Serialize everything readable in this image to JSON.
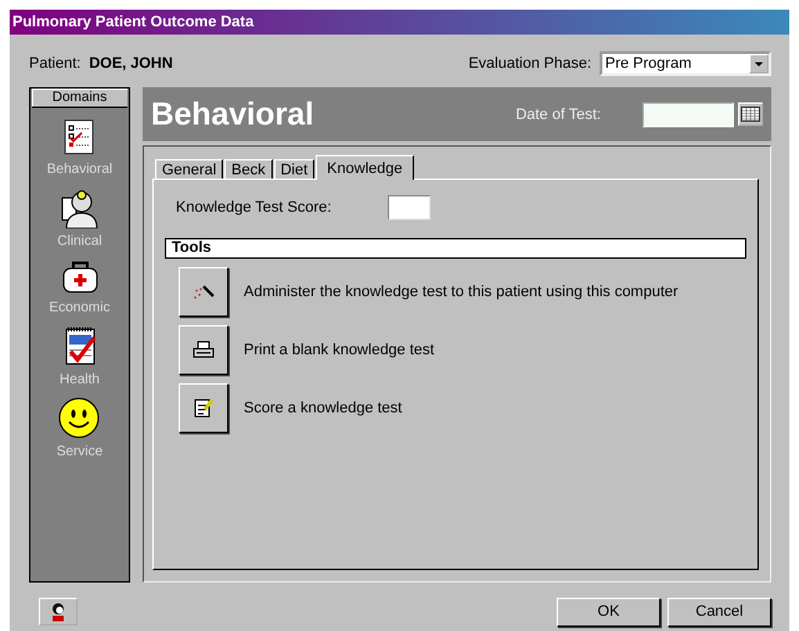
{
  "window": {
    "title": "Pulmonary Patient Outcome Data"
  },
  "patient": {
    "label": "Patient:",
    "name": "DOE, JOHN"
  },
  "evaluation_phase": {
    "label": "Evaluation Phase:",
    "value": "Pre Program"
  },
  "domains": {
    "title": "Domains",
    "items": [
      {
        "label": "Behavioral",
        "kind": "checklist"
      },
      {
        "label": "Clinical",
        "kind": "doctor"
      },
      {
        "label": "Economic",
        "kind": "bag"
      },
      {
        "label": "Health",
        "kind": "notepad"
      },
      {
        "label": "Service",
        "kind": "smiley"
      }
    ]
  },
  "header": {
    "title": "Behavioral",
    "date_label": "Date of Test:"
  },
  "tabs": [
    {
      "label": "General",
      "selected": false
    },
    {
      "label": "Beck",
      "selected": false
    },
    {
      "label": "Diet",
      "selected": false
    },
    {
      "label": "Knowledge",
      "selected": true
    }
  ],
  "score": {
    "label": "Knowledge Test Score:"
  },
  "tools": {
    "title": "Tools",
    "items": [
      {
        "label": "Administer the knowledge test to this patient using this computer",
        "kind": "wand"
      },
      {
        "label": "Print a blank knowledge test",
        "kind": "printer"
      },
      {
        "label": "Score a knowledge test",
        "kind": "score"
      }
    ]
  },
  "buttons": [
    "OK",
    "Cancel"
  ]
}
